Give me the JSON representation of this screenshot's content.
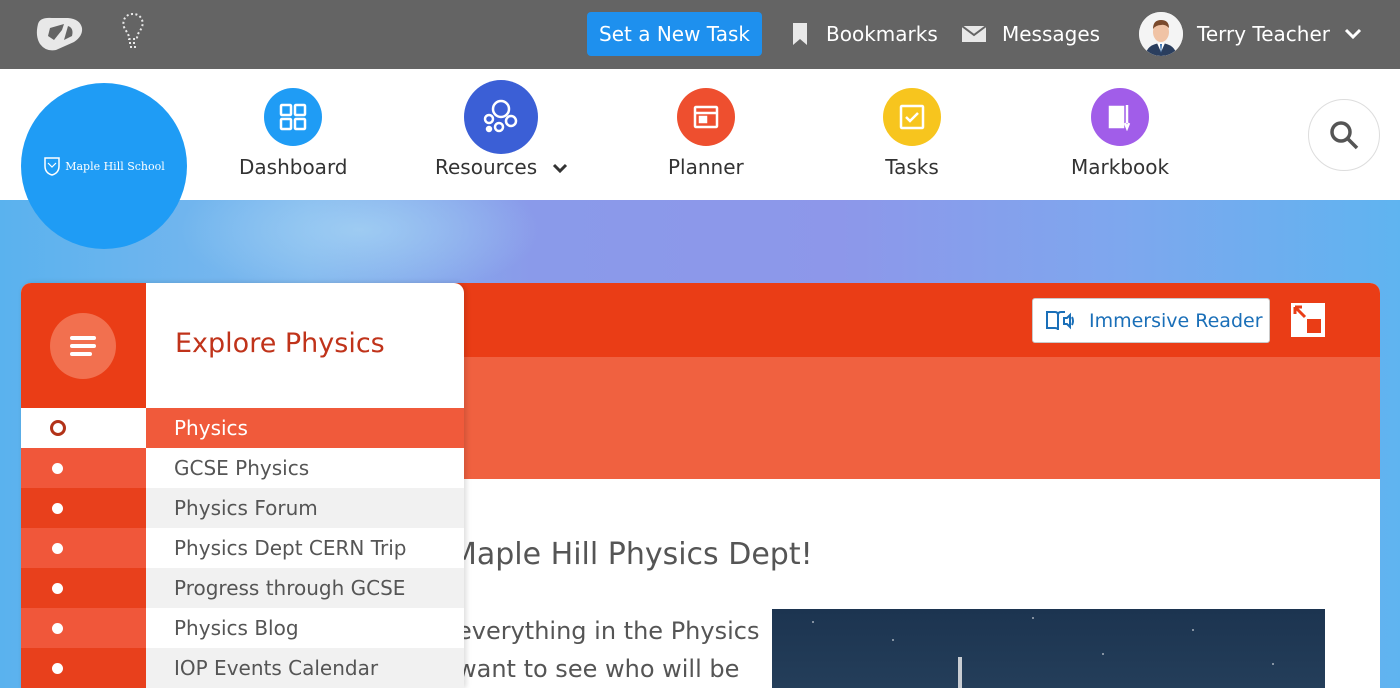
{
  "topbar": {
    "new_task_label": "Set a New Task",
    "bookmarks_label": "Bookmarks",
    "messages_label": "Messages",
    "user_name": "Terry Teacher"
  },
  "school": {
    "name": "Maple Hill School"
  },
  "nav": {
    "items": [
      {
        "label": "Dashboard",
        "color": "#1f9cf5",
        "icon": "grid-icon"
      },
      {
        "label": "Resources",
        "color": "#3b5fd6",
        "icon": "bubbles-icon"
      },
      {
        "label": "Planner",
        "color": "#ee4f2f",
        "icon": "planner-icon"
      },
      {
        "label": "Tasks",
        "color": "#f7c51e",
        "icon": "checkbox-icon"
      },
      {
        "label": "Markbook",
        "color": "#a15de9",
        "icon": "book-icon"
      }
    ]
  },
  "card": {
    "immersive_reader_label": "Immersive Reader",
    "welcome_text": "Maple Hill Physics Dept!",
    "body_line_1": "everything in the Physics",
    "body_line_2": "want to see who will be"
  },
  "side_menu": {
    "title": "Explore Physics",
    "items": [
      {
        "label": "Physics"
      },
      {
        "label": "GCSE Physics"
      },
      {
        "label": "Physics Forum"
      },
      {
        "label": "Physics Dept CERN Trip"
      },
      {
        "label": "Progress through GCSE"
      },
      {
        "label": "Physics Blog"
      },
      {
        "label": "IOP Events Calendar"
      }
    ]
  }
}
